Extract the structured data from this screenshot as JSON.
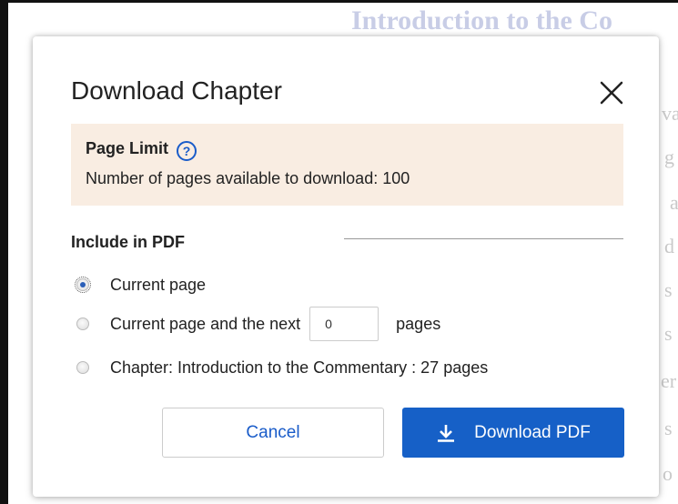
{
  "background": {
    "title": "Introduction to the Co",
    "fragments": [
      "va",
      "g",
      "a",
      "d",
      "s",
      "s",
      "er",
      "s",
      "o"
    ]
  },
  "dialog": {
    "title": "Download Chapter",
    "close_icon": "close-icon",
    "page_limit": {
      "heading": "Page Limit",
      "help_icon": "question-circle-icon",
      "text": "Number of pages available to download: 100"
    },
    "include_section": {
      "label": "Include in PDF",
      "options": [
        {
          "label": "Current page",
          "checked": true
        },
        {
          "label": "Current page and the next",
          "checked": false,
          "input_value": "0",
          "suffix": "pages"
        },
        {
          "label": "Chapter: Introduction to the Commentary : 27 pages",
          "checked": false
        }
      ]
    },
    "buttons": {
      "cancel": "Cancel",
      "download": "Download PDF",
      "download_icon": "download-icon"
    }
  },
  "colors": {
    "accent": "#1660c7",
    "page_limit_bg": "#f9ede2",
    "background_title": "#c8cde6"
  }
}
